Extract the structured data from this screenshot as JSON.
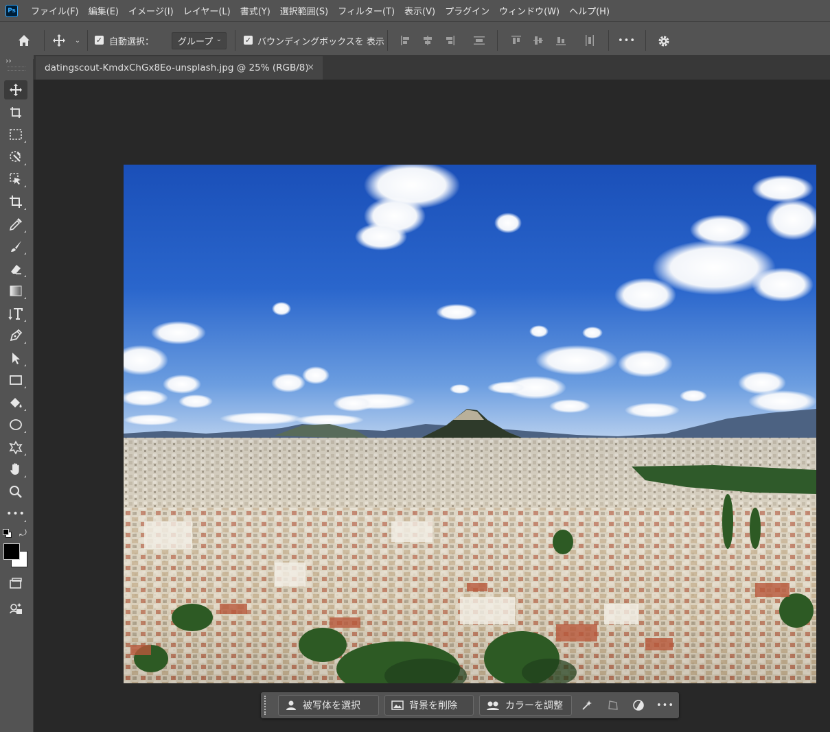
{
  "app": {
    "logo_text": "Ps"
  },
  "menu": [
    {
      "label": "ファイル(F)"
    },
    {
      "label": "編集(E)"
    },
    {
      "label": "イメージ(I)"
    },
    {
      "label": "レイヤー(L)"
    },
    {
      "label": "書式(Y)"
    },
    {
      "label": "選択範囲(S)"
    },
    {
      "label": "フィルター(T)"
    },
    {
      "label": "表示(V)"
    },
    {
      "label": "プラグイン"
    },
    {
      "label": "ウィンドウ(W)"
    },
    {
      "label": "ヘルプ(H)"
    }
  ],
  "options": {
    "auto_select_label": "自動選択：",
    "auto_select_checked": true,
    "auto_select_target": "グループ",
    "bounding_box_label": "バウンディングボックスを 表示",
    "bounding_box_checked": true,
    "more_label": "•••"
  },
  "document": {
    "tab_title": "datingscout-KmdxChGx8Eo-unsplash.jpg @ 25% (RGB/8)",
    "close_glyph": "×"
  },
  "toolbar": {
    "collapse_glyph": "››",
    "tools": [
      {
        "name": "move-tool",
        "active": true
      },
      {
        "name": "artboard-tool"
      },
      {
        "name": "rectangular-marquee-tool"
      },
      {
        "name": "object-selection-tool"
      },
      {
        "name": "quick-selection-tool"
      },
      {
        "name": "crop-tool"
      },
      {
        "name": "eyedropper-tool"
      },
      {
        "name": "brush-tool"
      },
      {
        "name": "eraser-tool"
      },
      {
        "name": "gradient-tool"
      },
      {
        "name": "type-tool"
      },
      {
        "name": "pen-tool"
      },
      {
        "name": "path-selection-tool"
      },
      {
        "name": "rectangle-tool"
      },
      {
        "name": "paint-bucket-tool"
      },
      {
        "name": "ellipse-tool"
      },
      {
        "name": "custom-shape-tool"
      },
      {
        "name": "hand-tool"
      },
      {
        "name": "zoom-tool"
      },
      {
        "name": "edit-toolbar"
      }
    ],
    "foreground_color": "#000000",
    "background_color": "#ffffff"
  },
  "taskbar": {
    "select_subject_label": "被写体を選択",
    "remove_background_label": "背景を削除",
    "adjust_color_label": "カラーを調整",
    "more_label": "•••"
  },
  "colors": {
    "chrome": "#535353",
    "workspace": "#282828",
    "accent_ps": "#31a8ff"
  }
}
